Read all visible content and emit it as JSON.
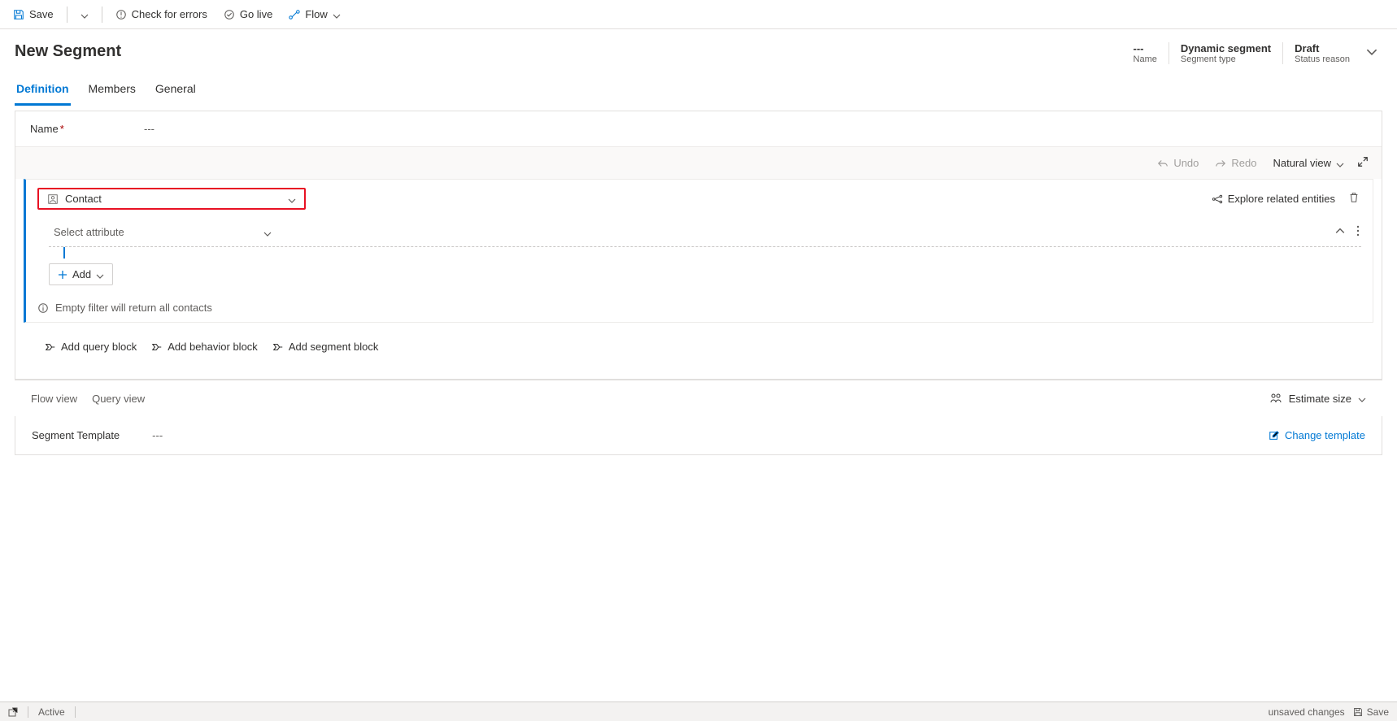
{
  "topbar": {
    "save": "Save",
    "check_errors": "Check for errors",
    "go_live": "Go live",
    "flow": "Flow"
  },
  "header": {
    "title": "New Segment",
    "meta": {
      "name_val": "---",
      "name_lbl": "Name",
      "type_val": "Dynamic segment",
      "type_lbl": "Segment type",
      "status_val": "Draft",
      "status_lbl": "Status reason"
    }
  },
  "tabs": {
    "definition": "Definition",
    "members": "Members",
    "general": "General"
  },
  "name_field": {
    "label": "Name",
    "value": "---"
  },
  "toolbar": {
    "undo": "Undo",
    "redo": "Redo",
    "natural_view": "Natural view"
  },
  "query": {
    "entity": "Contact",
    "explore_related": "Explore related entities",
    "select_attribute": "Select attribute",
    "add": "Add",
    "empty_msg": "Empty filter will return all contacts"
  },
  "add_blocks": {
    "query": "Add query block",
    "behavior": "Add behavior block",
    "segment": "Add segment block"
  },
  "views": {
    "flow": "Flow view",
    "query": "Query view",
    "estimate": "Estimate size"
  },
  "template": {
    "label": "Segment Template",
    "value": "---",
    "change": "Change template"
  },
  "statusbar": {
    "active": "Active",
    "unsaved": "unsaved changes",
    "save": "Save"
  },
  "icons": {
    "save": "save-icon",
    "error": "error-icon",
    "check": "check-icon",
    "flow_icon": "flow-icon"
  }
}
